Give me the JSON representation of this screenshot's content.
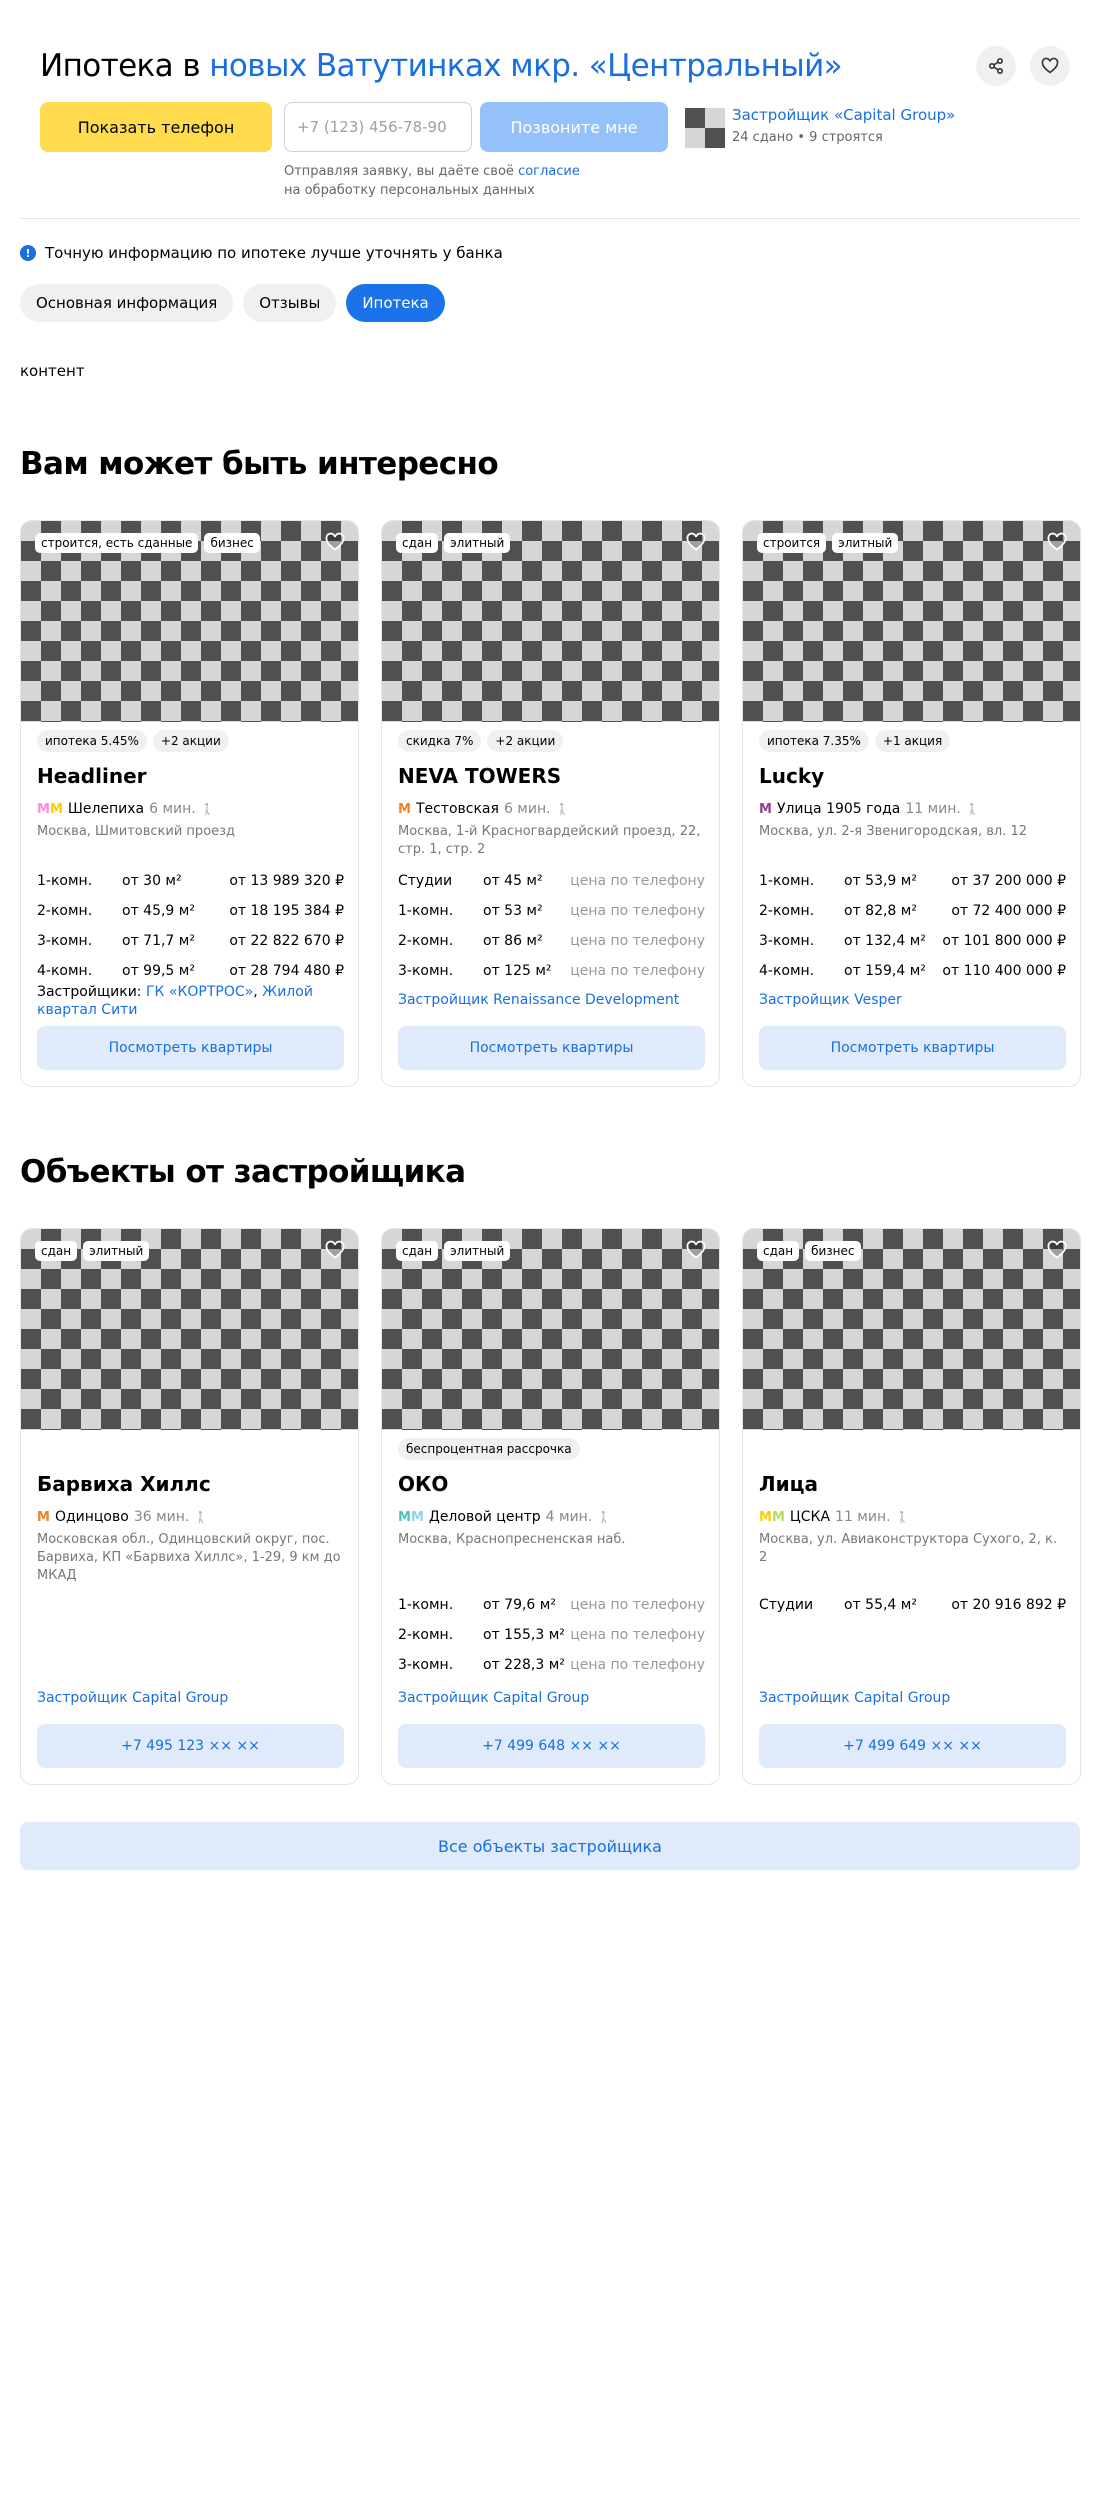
{
  "header": {
    "title_prefix": "Ипотека в",
    "title_accent": "новых Ватутинках мкр. «Центральный»",
    "share_icon": "share-icon",
    "favorite_icon": "heart-icon"
  },
  "contact": {
    "show_phone_label": "Показать телефон",
    "phone_placeholder": "+7 (123) 456-78-90",
    "call_me_label": "Позвоните мне",
    "consent_prefix": "Отправляя заявку, вы даёте своё",
    "consent_link": "согласие",
    "consent_suffix": "на обработку персональных данных",
    "developer_name": "Застройщик «Capital Group»",
    "developer_stats": "24 сдано • 9 строятся"
  },
  "notice": {
    "text": "Точную информацию по ипотеке лучше уточнять у банка"
  },
  "tabs": [
    {
      "label": "Основная информация",
      "active": false
    },
    {
      "label": "Отзывы",
      "active": false
    },
    {
      "label": "Ипотека",
      "active": true
    }
  ],
  "content_label": "контент",
  "interesting": {
    "title": "Вам может быть интересно",
    "cards": [
      {
        "tags": [
          "строится, есть сданные",
          "бизнес"
        ],
        "promos": [
          "ипотека 5.45%",
          "+2 акции"
        ],
        "name": "Headliner",
        "metro": "Шелепиха",
        "metro_time": "6 мин.",
        "metro_colors": [
          "#ff8cd0",
          "#ffcc00"
        ],
        "address": "Москва, Шмитовский проезд",
        "flats": [
          {
            "type": "1-комн.",
            "area": "от 30 м²",
            "price": "от 13 989 320 ₽"
          },
          {
            "type": "2-комн.",
            "area": "от 45,9 м²",
            "price": "от 18 195 384 ₽"
          },
          {
            "type": "3-комн.",
            "area": "от 71,7 м²",
            "price": "от 22 822 670 ₽"
          },
          {
            "type": "4-комн.",
            "area": "от 99,5 м²",
            "price": "от 28 794 480 ₽"
          }
        ],
        "developer_label": "Застройщики:",
        "developer_links": [
          "ГК «КОРТРОС»",
          "Жилой квартал Сити"
        ],
        "button": "Посмотреть квартиры"
      },
      {
        "tags": [
          "сдан",
          "элитный"
        ],
        "promos": [
          "скидка 7%",
          "+2 акции"
        ],
        "name": "NEVA TOWERS",
        "metro": "Тестовская",
        "metro_time": "6 мин.",
        "metro_colors": [
          "#f58220"
        ],
        "address": "Москва, 1-й Красногвардейский проезд, 22, стр. 1, стр. 2",
        "flats": [
          {
            "type": "Студии",
            "area": "от 45 м²",
            "price": "цена по телефону"
          },
          {
            "type": "1-комн.",
            "area": "от 53 м²",
            "price": "цена по телефону"
          },
          {
            "type": "2-комн.",
            "area": "от 86 м²",
            "price": "цена по телефону"
          },
          {
            "type": "3-комн.",
            "area": "от 125 м²",
            "price": "цена по телефону"
          }
        ],
        "developer": "Застройщик Renaissance Development",
        "button": "Посмотреть квартиры"
      },
      {
        "tags": [
          "строится",
          "элитный"
        ],
        "promos": [
          "ипотека 7.35%",
          "+1 акция"
        ],
        "name": "Lucky",
        "metro": "Улица 1905 года",
        "metro_time": "11 мин.",
        "metro_colors": [
          "#943e90"
        ],
        "address": "Москва, ул. 2-я Звенигородская, вл. 12",
        "flats": [
          {
            "type": "1-комн.",
            "area": "от 53,9 м²",
            "price": "от 37 200 000 ₽"
          },
          {
            "type": "2-комн.",
            "area": "от 82,8 м²",
            "price": "от 72 400 000 ₽"
          },
          {
            "type": "3-комн.",
            "area": "от 132,4 м²",
            "price": "от 101 800 000 ₽"
          },
          {
            "type": "4-комн.",
            "area": "от 159,4 м²",
            "price": "от 110 400 000 ₽"
          }
        ],
        "developer": "Застройщик Vesper",
        "button": "Посмотреть квартиры"
      }
    ]
  },
  "developer_objects": {
    "title": "Объекты от застройщика",
    "cards": [
      {
        "tags": [
          "сдан",
          "элитный"
        ],
        "promos": [],
        "name": "Барвиха Хиллс",
        "metro": "Одинцово",
        "metro_time": "36 мин.",
        "metro_colors": [
          "#f58220"
        ],
        "address": "Московская обл., Одинцовский округ, пос. Барвиха, КП «Барвиха Хиллс», 1-29, 9 км до МКАД",
        "flats": [],
        "developer": "Застройщик Capital Group",
        "button": "+7 495 123 ×× ××"
      },
      {
        "tags": [
          "сдан",
          "элитный"
        ],
        "promos": [
          "беспроцентная рассрочка"
        ],
        "name": "ОКО",
        "metro": "Деловой центр",
        "metro_time": "4 мин.",
        "metro_colors": [
          "#4fc3b8",
          "#8fd3f0"
        ],
        "address": "Москва, Краснопресненская наб.",
        "flats": [
          {
            "type": "1-комн.",
            "area": "от 79,6 м²",
            "price": "цена по телефону"
          },
          {
            "type": "2-комн.",
            "area": "от 155,3 м²",
            "price": "цена по телефону"
          },
          {
            "type": "3-комн.",
            "area": "от 228,3 м²",
            "price": "цена по телефону"
          }
        ],
        "developer": "Застройщик Capital Group",
        "button": "+7 499 648 ×× ××"
      },
      {
        "tags": [
          "сдан",
          "бизнес"
        ],
        "promos": [],
        "name": "Лица",
        "metro": "ЦСКА",
        "metro_time": "11 мин.",
        "metro_colors": [
          "#ffcc00",
          "#b8dc5a"
        ],
        "address": "Москва, ул. Авиаконструктора Сухого, 2, к. 2",
        "flats": [
          {
            "type": "Студии",
            "area": "от 55,4 м²",
            "price": "от 20 916 892 ₽"
          }
        ],
        "developer": "Застройщик Capital Group",
        "button": "+7 499 649 ×× ××"
      }
    ]
  },
  "all_objects_button": "Все объекты застройщика"
}
